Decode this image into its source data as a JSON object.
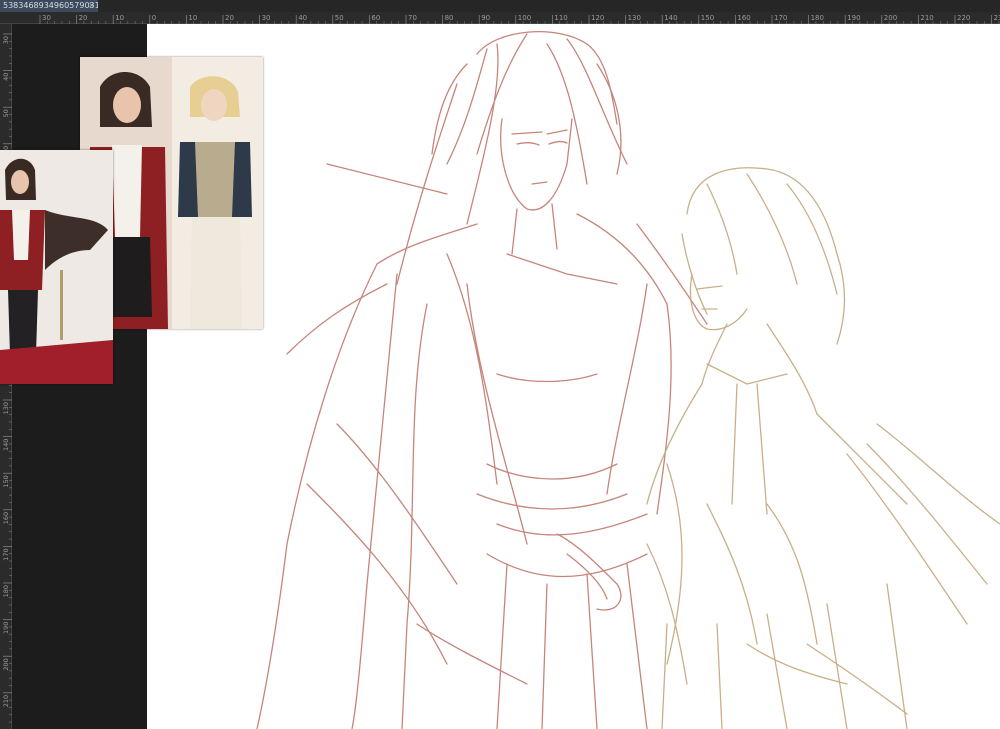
{
  "document_tab": {
    "title": "5383468934960579031",
    "close_icon": "close-icon"
  },
  "hruler_labels": [
    "30",
    "20",
    "10",
    "0",
    "10",
    "20",
    "30",
    "40",
    "50",
    "60",
    "70",
    "80",
    "90",
    "100",
    "110",
    "120",
    "130",
    "140",
    "150",
    "160",
    "170",
    "180",
    "190",
    "200",
    "210",
    "220",
    "230"
  ],
  "vruler_labels": [
    "30",
    "40",
    "50",
    "60",
    "70",
    "80",
    "90",
    "100",
    "110",
    "120",
    "130",
    "140",
    "150",
    "160",
    "170",
    "180",
    "190",
    "200",
    "210"
  ],
  "colors": {
    "workspace": "#1c1c1c",
    "canvas": "#ffffff",
    "sketch_character_left": "#c0786c",
    "sketch_character_right": "#c4a77c"
  },
  "reference_images": [
    {
      "name": "reference-two-characters",
      "description_icon": "image-icon"
    },
    {
      "name": "reference-full-body",
      "description_icon": "image-icon"
    }
  ]
}
